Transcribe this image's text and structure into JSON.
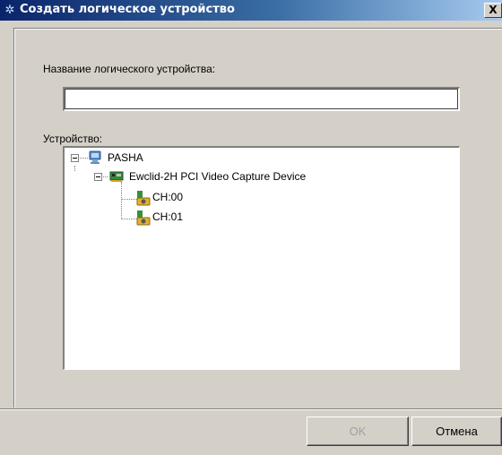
{
  "window": {
    "title": "Создать логическое устройство",
    "close_label": "X"
  },
  "form": {
    "name_label": "Название логического устройства:",
    "name_value": "",
    "device_label": "Устройство:"
  },
  "tree": {
    "root": {
      "label": "PASHA",
      "icon": "computer-icon",
      "expanded": true
    },
    "device": {
      "label": "Ewclid-2H PCI Video Capture Device",
      "icon": "capture-card-icon",
      "expanded": true
    },
    "channels": [
      {
        "label": "CH:00",
        "icon": "camera-channel-icon"
      },
      {
        "label": "CH:01",
        "icon": "camera-channel-icon"
      }
    ]
  },
  "buttons": {
    "ok_label": "OK",
    "ok_enabled": false,
    "cancel_label": "Отмена"
  },
  "colors": {
    "titlebar_start": "#0a246a",
    "titlebar_end": "#a6caf0",
    "face": "#d4d0c8",
    "disabled_text": "#a0a0a0"
  }
}
